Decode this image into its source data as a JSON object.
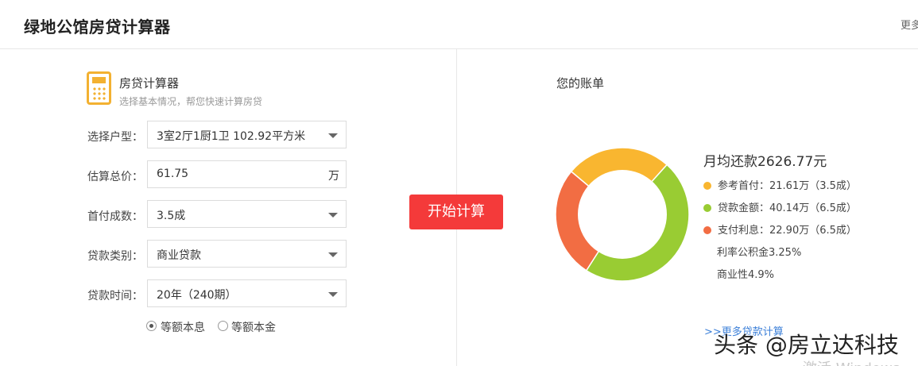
{
  "header": {
    "title": "绿地公馆房贷计算器",
    "more": "更多"
  },
  "calculator": {
    "title": "房贷计算器",
    "subtitle": "选择基本情况，帮您快速计算房贷",
    "fields": [
      {
        "label": "选择户型：",
        "value": "3室2厅1厨1卫 102.92平方米"
      },
      {
        "label": "估算总价：",
        "value": "61.75",
        "unit": "万"
      },
      {
        "label": "首付成数：",
        "value": "3.5成"
      },
      {
        "label": "贷款类别：",
        "value": "商业贷款"
      },
      {
        "label": "贷款时间：",
        "value": "20年（240期）"
      }
    ],
    "repayment_options": [
      {
        "label": "等额本息",
        "checked": true
      },
      {
        "label": "等额本金",
        "checked": false
      }
    ]
  },
  "start_button": "开始计算",
  "bill": {
    "title": "您的账单",
    "monthly": "月均还款2626.77元",
    "items": [
      {
        "label": "参考首付：21.61万（3.5成）",
        "color": "#f9b630",
        "amount": 21.61
      },
      {
        "label": "贷款金额：40.14万（6.5成）",
        "color": "#99cc33",
        "amount": 40.14
      },
      {
        "label": "支付利息：22.90万（6.5成）",
        "color": "#f26d43",
        "amount": 22.9
      }
    ],
    "rate_lines": [
      "利率公积金3.25%",
      "商业性4.9%"
    ],
    "more_link": ">>更多贷款计算"
  },
  "watermark": "头条 @房立达科技",
  "activate_text": "激活 Windows"
}
